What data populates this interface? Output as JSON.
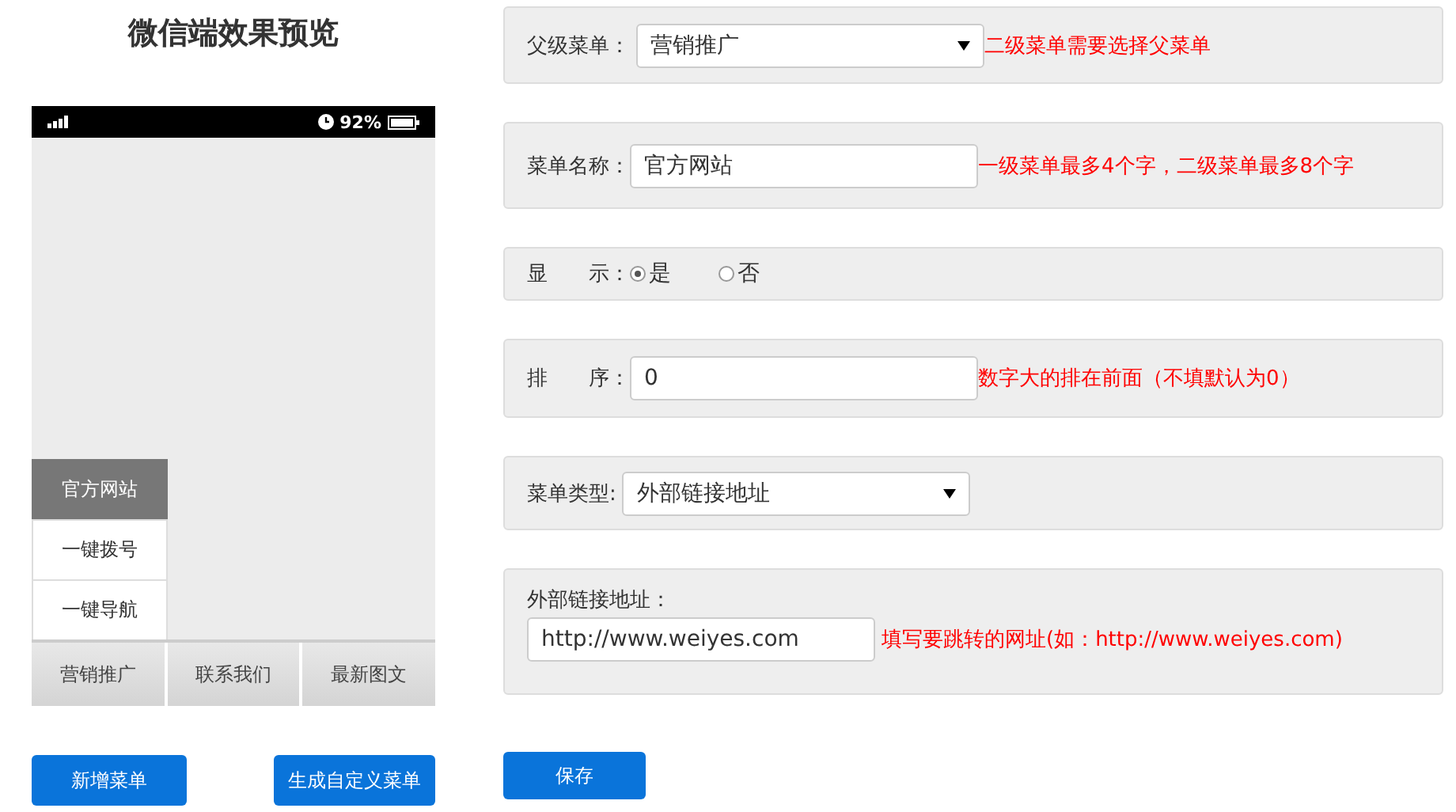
{
  "preview": {
    "title": "微信端效果预览",
    "status_bar": {
      "battery_text": "92%"
    },
    "submenu": [
      {
        "label": "官方网站",
        "selected": true
      },
      {
        "label": "一键拨号",
        "selected": false
      },
      {
        "label": "一键导航",
        "selected": false
      }
    ],
    "menu": [
      {
        "label": "营销推广"
      },
      {
        "label": "联系我们"
      },
      {
        "label": "最新图文"
      }
    ],
    "buttons": [
      "新增菜单",
      "生成自定义菜单"
    ]
  },
  "form": {
    "rows": [
      {
        "kind": "select",
        "label": "父级菜单：",
        "value": "营销推广",
        "hint": "二级菜单需要选择父菜单"
      },
      {
        "kind": "text",
        "label": "菜单名称：",
        "value": "官方网站",
        "hint": "一级菜单最多4个字，二级菜单最多8个字"
      },
      {
        "kind": "radio",
        "label": "显　　示：",
        "options": [
          {
            "label": "是",
            "selected": true
          },
          {
            "label": "否",
            "selected": false
          }
        ]
      },
      {
        "kind": "text",
        "label": "排　　序：",
        "value": "0",
        "hint": "数字大的排在前面（不填默认为0）"
      },
      {
        "kind": "select",
        "label": "菜单类型:",
        "value": "外部链接地址"
      },
      {
        "kind": "stacked",
        "label": "外部链接地址：",
        "value": "http://www.weiyes.com",
        "hint": "填写要跳转的网址(如：http://www.weiyes.com)"
      }
    ],
    "save_button": "保存"
  }
}
